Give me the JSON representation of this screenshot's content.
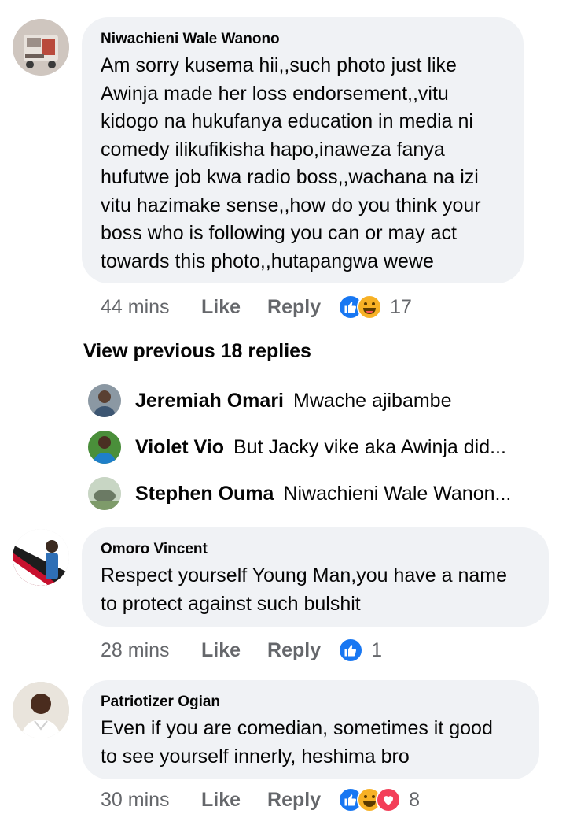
{
  "comments": [
    {
      "author": "Niwachieni Wale Wanono",
      "lines": [
        "Am sorry kusema hii,,such photo just like",
        "Awinja made her loss endorsement,,vitu",
        "kidogo na hukufanya education in media ni",
        "comedy ilikufikisha hapo,inaweza fanya",
        "hufutwe job kwa radio boss,,wachana na izi",
        "vitu hazimake sense,,how do you think your",
        "boss who is following you can or may act",
        "towards this photo,,hutapangwa wewe"
      ],
      "time": "44 mins",
      "like_label": "Like",
      "reply_label": "Reply",
      "reactions": [
        "like-icon",
        "haha-icon"
      ],
      "reaction_count": "17"
    },
    {
      "author": "Omoro Vincent",
      "lines": [
        "Respect yourself Young Man,you have a name",
        "to protect against such bulshit"
      ],
      "time": "28 mins",
      "like_label": "Like",
      "reply_label": "Reply",
      "reactions": [
        "like-icon"
      ],
      "reaction_count": "1"
    },
    {
      "author": "Patriotizer Ogian",
      "lines": [
        "Even if you are comedian, sometimes it good",
        "to see yourself innerly, heshima bro"
      ],
      "time": "30 mins",
      "like_label": "Like",
      "reply_label": "Reply",
      "reactions": [
        "like-icon",
        "haha-icon",
        "love-icon"
      ],
      "reaction_count": "8"
    }
  ],
  "view_previous": "View previous 18 replies",
  "replies": [
    {
      "name": "Jeremiah Omari",
      "text": "Mwache ajibambe"
    },
    {
      "name": "Violet Vio",
      "text": "But Jacky vike aka Awinja did..."
    },
    {
      "name": "Stephen Ouma",
      "text": "Niwachieni Wale Wanon..."
    }
  ],
  "colors": {
    "bubble": "#f0f2f5",
    "meta_text": "#65676b",
    "like_blue": "#1877f2",
    "haha_yellow": "#f7b125",
    "love_red": "#f33e58"
  }
}
